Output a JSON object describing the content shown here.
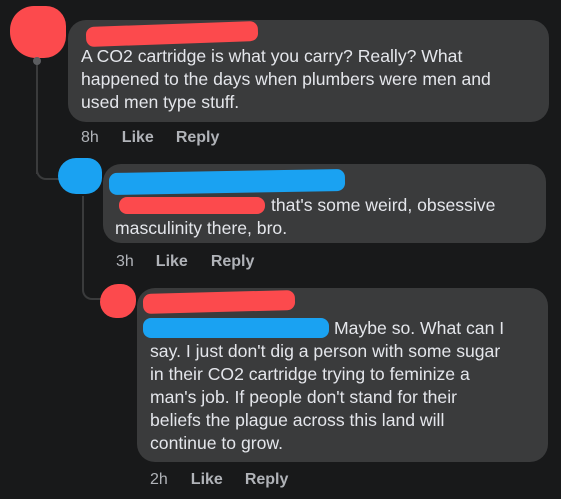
{
  "comments": [
    {
      "text": "A CO2 cartridge is what you carry? Really? What\nhappened to the days when plumbers were men and\nused men type stuff.",
      "time": "8h",
      "like": "Like",
      "reply": "Reply"
    },
    {
      "text_inline": "that's some weird, obsessive",
      "text_rest": "masculinity there, bro.",
      "time": "3h",
      "like": "Like",
      "reply": "Reply"
    },
    {
      "text_inline": "Maybe so. What can I",
      "text_rest": "say. I just don't dig a person with some sugar\nin their CO2 cartridge trying to feminize a\nman's job. If people don't stand for their\nbeliefs the plague across this land will\ncontinue to grow.",
      "time": "2h",
      "like": "Like",
      "reply": "Reply"
    }
  ],
  "colors": {
    "background": "#18191a",
    "bubble": "#3a3b3c",
    "text": "#e4e6eb",
    "meta": "#b0b3b8",
    "redaction_red": "#fc4a4d",
    "redaction_blue": "#1aa2f2"
  }
}
